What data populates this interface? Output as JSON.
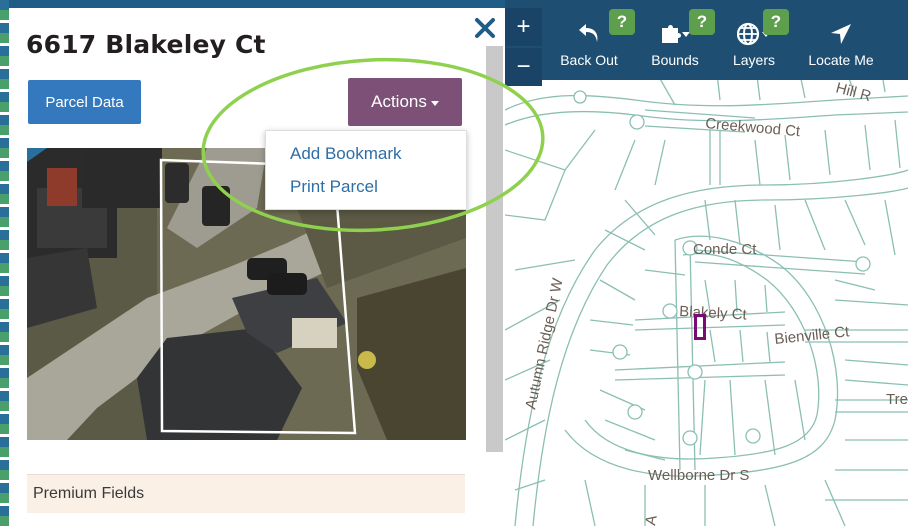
{
  "panel": {
    "title": "6617 Blakeley Ct",
    "parcel_data_label": "Parcel Data",
    "actions_label": "Actions",
    "dropdown": [
      "Add Bookmark",
      "Print Parcel"
    ],
    "premium_label": "Premium Fields"
  },
  "toolbar": {
    "zoom_in": "+",
    "zoom_out": "−",
    "tools": [
      {
        "label": "Back Out",
        "icon": "back-arrow-icon",
        "help": "?"
      },
      {
        "label": "Bounds",
        "icon": "puzzle-icon",
        "help": "?"
      },
      {
        "label": "Layers",
        "icon": "globe-icon",
        "help": "?"
      },
      {
        "label": "Locate Me",
        "icon": "location-arrow-icon"
      }
    ]
  },
  "map": {
    "streets": [
      "Creekwood Ct",
      "Conde Ct",
      "Blakely Ct",
      "Bienville Ct",
      "Autumn Ridge Dr W",
      "Wellborne Dr S",
      "Tre",
      "Hill R"
    ]
  },
  "colors": {
    "toolbar": "#1f4e73",
    "actions_button": "#7c5077",
    "parcel_button": "#3479bd",
    "help_badge": "#5e9f4d",
    "parcel_lines": "#8bbfb3",
    "highlight": "#7a0b72",
    "annotation_ellipse": "#8fd14f"
  }
}
